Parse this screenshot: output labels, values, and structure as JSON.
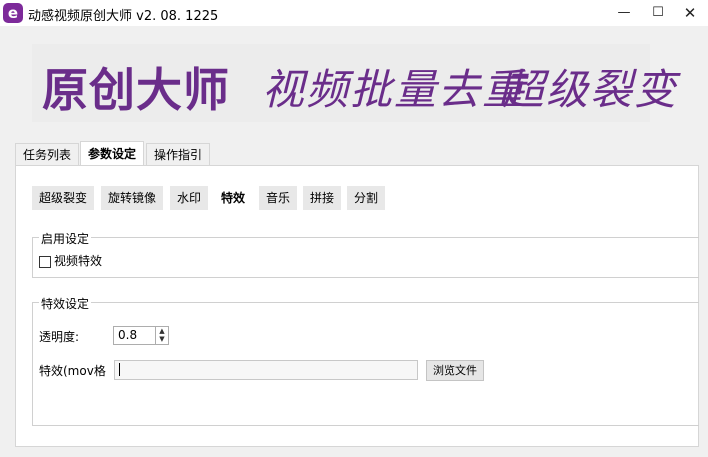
{
  "window": {
    "app_icon_glyph": "e",
    "title": "动感视频原创大师  v2. 08. 1225",
    "minimize_glyph": "—",
    "maximize_glyph": "☐",
    "close_glyph": "✕"
  },
  "banner": {
    "logo": "原创大师",
    "slogan1": "视频批量去重",
    "slogan2": "超级裂变",
    "color": "#6a2d8a"
  },
  "main_tabs": [
    {
      "label": "任务列表",
      "active": false
    },
    {
      "label": "参数设定",
      "active": true
    },
    {
      "label": "操作指引",
      "active": false
    }
  ],
  "sub_tabs": [
    {
      "label": "超级裂变",
      "active": false
    },
    {
      "label": "旋转镜像",
      "active": false
    },
    {
      "label": "水印",
      "active": false
    },
    {
      "label": "特效",
      "active": true
    },
    {
      "label": "音乐",
      "active": false
    },
    {
      "label": "拼接",
      "active": false
    },
    {
      "label": "分割",
      "active": false
    }
  ],
  "enable_group": {
    "title": "启用设定",
    "checkbox_label": "视频特效",
    "checked": false
  },
  "effect_group": {
    "title": "特效设定",
    "opacity_label": "透明度:",
    "opacity_value": "0.8",
    "effect_label": "特效(mov格",
    "effect_value": "",
    "browse_label": "浏览文件"
  }
}
